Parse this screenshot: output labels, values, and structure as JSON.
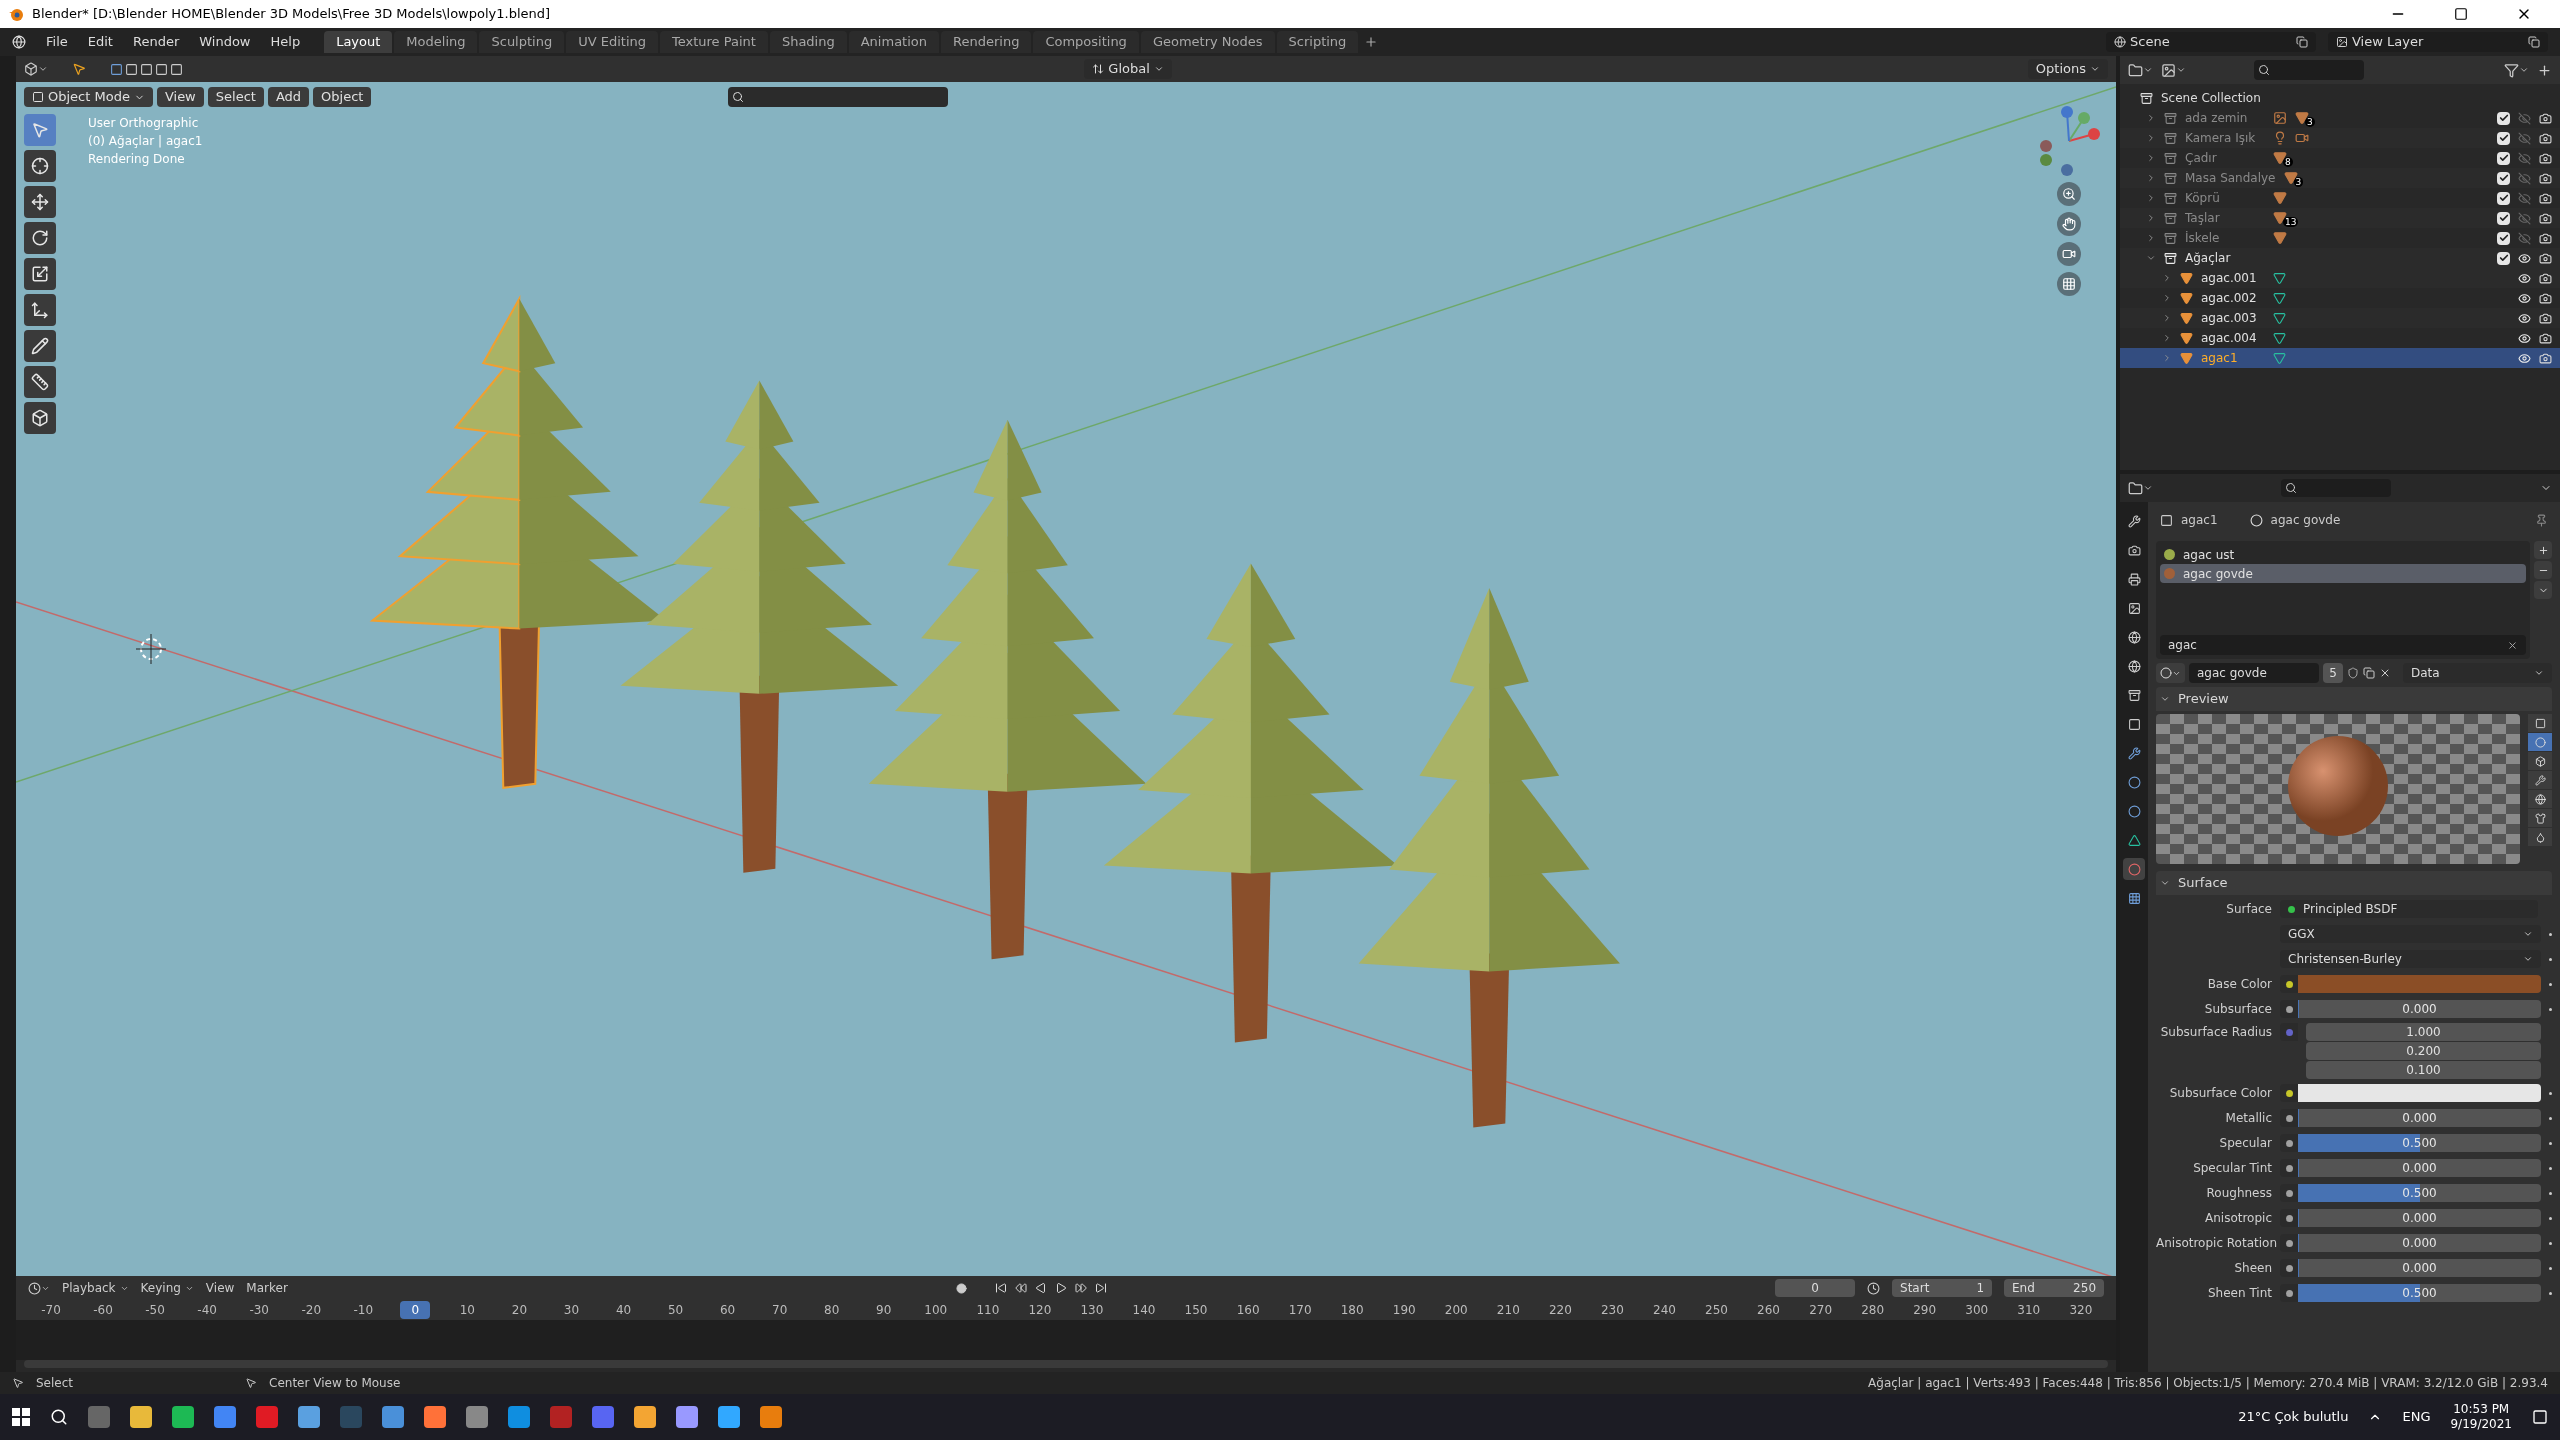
{
  "window": {
    "title": "Blender* [D:\\Blender HOME\\Blender 3D Models\\Free 3D Models\\lowpoly1.blend]"
  },
  "menu": [
    "File",
    "Edit",
    "Render",
    "Window",
    "Help"
  ],
  "workspaces": [
    {
      "label": "Layout",
      "selected": true
    },
    {
      "label": "Modeling",
      "selected": false
    },
    {
      "label": "Sculpting",
      "selected": false
    },
    {
      "label": "UV Editing",
      "selected": false
    },
    {
      "label": "Texture Paint",
      "selected": false
    },
    {
      "label": "Shading",
      "selected": false
    },
    {
      "label": "Animation",
      "selected": false
    },
    {
      "label": "Rendering",
      "selected": false
    },
    {
      "label": "Compositing",
      "selected": false
    },
    {
      "label": "Geometry Nodes",
      "selected": false
    },
    {
      "label": "Scripting",
      "selected": false
    }
  ],
  "scene": "Scene",
  "view_layer": "View Layer",
  "viewport_header": {
    "orientation": "Global",
    "options": "Options",
    "mode": "Object Mode",
    "menus": [
      "View",
      "Select",
      "Add",
      "Object"
    ]
  },
  "viewport_info": [
    "User Orthographic",
    "(0) Ağaçlar | agac1",
    "Rendering Done"
  ],
  "outliner": {
    "root": "Scene Collection",
    "collections": [
      {
        "name": "ada zemin",
        "expanded": false,
        "visible": false,
        "enabled": true,
        "badges": [
          {
            "kind": "image"
          },
          {
            "kind": "mesh",
            "count": "3"
          }
        ]
      },
      {
        "name": "Kamera Işık",
        "expanded": false,
        "visible": false,
        "enabled": true,
        "badges": [
          {
            "kind": "light"
          },
          {
            "kind": "camera"
          }
        ]
      },
      {
        "name": "Çadır",
        "expanded": false,
        "visible": false,
        "enabled": true,
        "badges": [
          {
            "kind": "mesh",
            "count": "8"
          }
        ]
      },
      {
        "name": "Masa Sandalye",
        "expanded": false,
        "visible": false,
        "enabled": true,
        "badges": [
          {
            "kind": "mesh",
            "count": "3"
          }
        ]
      },
      {
        "name": "Köprü",
        "expanded": false,
        "visible": false,
        "enabled": true,
        "badges": [
          {
            "kind": "mesh"
          }
        ]
      },
      {
        "name": "Taşlar",
        "expanded": false,
        "visible": false,
        "enabled": true,
        "badges": [
          {
            "kind": "mesh",
            "count": "13"
          }
        ]
      },
      {
        "name": "İskele",
        "expanded": false,
        "visible": false,
        "enabled": true,
        "badges": [
          {
            "kind": "mesh"
          }
        ]
      },
      {
        "name": "Ağaçlar",
        "expanded": true,
        "visible": true,
        "enabled": true,
        "children": [
          {
            "name": "agac.001",
            "selected": false
          },
          {
            "name": "agac.002",
            "selected": false
          },
          {
            "name": "agac.003",
            "selected": false
          },
          {
            "name": "agac.004",
            "selected": false
          },
          {
            "name": "agac1",
            "selected": true
          }
        ]
      }
    ]
  },
  "properties": {
    "object": "agac1",
    "material": "agac govde",
    "slots": [
      {
        "name": "agac ust",
        "color": "#9aac4a",
        "selected": false
      },
      {
        "name": "agac govde",
        "color": "#a0603a",
        "selected": true
      }
    ],
    "filter": "agac",
    "material_name": "agac govde",
    "users": "5",
    "link": "Data",
    "preview_title": "Preview",
    "surface_title": "Surface",
    "surface_label": "Surface",
    "surface_shader": "Principled BSDF",
    "dropdowns": [
      "GGX",
      "Christensen-Burley"
    ],
    "inputs": [
      {
        "kind": "color",
        "label": "Base Color",
        "color": "#8b4e26"
      },
      {
        "kind": "slider",
        "label": "Subsurface",
        "value": "0.000",
        "level": 0
      },
      {
        "kind": "vector",
        "label": "Subsurface Radius",
        "values": [
          "1.000",
          "0.200",
          "0.100"
        ]
      },
      {
        "kind": "color",
        "label": "Subsurface Color",
        "color": "#e6e6e6"
      },
      {
        "kind": "slider",
        "label": "Metallic",
        "value": "0.000",
        "level": 0
      },
      {
        "kind": "slider",
        "label": "Specular",
        "value": "0.500",
        "level": 0.5
      },
      {
        "kind": "slider",
        "label": "Specular Tint",
        "value": "0.000",
        "level": 0
      },
      {
        "kind": "slider",
        "label": "Roughness",
        "value": "0.500",
        "level": 0.5
      },
      {
        "kind": "slider",
        "label": "Anisotropic",
        "value": "0.000",
        "level": 0
      },
      {
        "kind": "slider",
        "label": "Anisotropic Rotation",
        "value": "0.000",
        "level": 0
      },
      {
        "kind": "slider",
        "label": "Sheen",
        "value": "0.000",
        "level": 0
      },
      {
        "kind": "slider",
        "label": "Sheen Tint",
        "value": "0.500",
        "level": 0.5
      }
    ]
  },
  "timeline": {
    "menus": [
      "Playback",
      "Keying",
      "View",
      "Marker"
    ],
    "frame": "0",
    "start_label": "Start",
    "start": "1",
    "end_label": "End",
    "end": "250",
    "ticks": [
      {
        "label": "-70",
        "selected": false
      },
      {
        "label": "-60",
        "selected": false
      },
      {
        "label": "-50",
        "selected": false
      },
      {
        "label": "-40",
        "selected": false
      },
      {
        "label": "-30",
        "selected": false
      },
      {
        "label": "-20",
        "selected": false
      },
      {
        "label": "-10",
        "selected": false
      },
      {
        "label": "0",
        "selected": true
      },
      {
        "label": "10",
        "selected": false
      },
      {
        "label": "20",
        "selected": false
      },
      {
        "label": "30",
        "selected": false
      },
      {
        "label": "40",
        "selected": false
      },
      {
        "label": "50",
        "selected": false
      },
      {
        "label": "60",
        "selected": false
      },
      {
        "label": "70",
        "selected": false
      },
      {
        "label": "80",
        "selected": false
      },
      {
        "label": "90",
        "selected": false
      },
      {
        "label": "100",
        "selected": false
      },
      {
        "label": "110",
        "selected": false
      },
      {
        "label": "120",
        "selected": false
      },
      {
        "label": "130",
        "selected": false
      },
      {
        "label": "140",
        "selected": false
      },
      {
        "label": "150",
        "selected": false
      },
      {
        "label": "160",
        "selected": false
      },
      {
        "label": "170",
        "selected": false
      },
      {
        "label": "180",
        "selected": false
      },
      {
        "label": "190",
        "selected": false
      },
      {
        "label": "200",
        "selected": false
      },
      {
        "label": "210",
        "selected": false
      },
      {
        "label": "220",
        "selected": false
      },
      {
        "label": "230",
        "selected": false
      },
      {
        "label": "240",
        "selected": false
      },
      {
        "label": "250",
        "selected": false
      },
      {
        "label": "260",
        "selected": false
      },
      {
        "label": "270",
        "selected": false
      },
      {
        "label": "280",
        "selected": false
      },
      {
        "label": "290",
        "selected": false
      },
      {
        "label": "300",
        "selected": false
      },
      {
        "label": "310",
        "selected": false
      },
      {
        "label": "320",
        "selected": false
      }
    ]
  },
  "status_bar": {
    "left": "Select",
    "middle": "Center View to Mouse",
    "right": "Ağaçlar | agac1 | Verts:493 | Faces:448 | Tris:856 | Objects:1/5 | Memory: 270.4 MiB | VRAM: 3.2/12.0 GiB | 2.93.4"
  },
  "taskbar": {
    "weather": "21°C  Çok bulutlu",
    "language": "ENG",
    "time": "10:53 PM",
    "date": "9/19/2021"
  }
}
